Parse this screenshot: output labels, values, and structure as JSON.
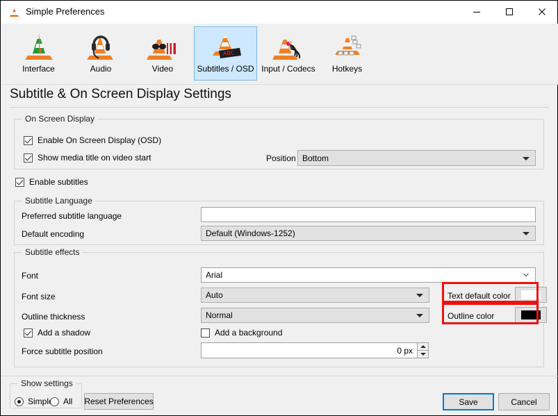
{
  "window": {
    "title": "Simple Preferences",
    "icon": "vlc-cone-icon",
    "minimize_label": "—",
    "maximize_label": "□",
    "close_label": "✕"
  },
  "toolbar": {
    "tabs": [
      {
        "label": "Interface",
        "icon": "vlc-interface-icon",
        "selected": false
      },
      {
        "label": "Audio",
        "icon": "vlc-audio-icon",
        "selected": false
      },
      {
        "label": "Video",
        "icon": "vlc-video-icon",
        "selected": false
      },
      {
        "label": "Subtitles / OSD",
        "icon": "vlc-subtitles-icon",
        "selected": true
      },
      {
        "label": "Input / Codecs",
        "icon": "vlc-input-icon",
        "selected": false
      },
      {
        "label": "Hotkeys",
        "icon": "vlc-hotkeys-icon",
        "selected": false
      }
    ]
  },
  "page": {
    "title": "Subtitle & On Screen Display Settings"
  },
  "osd_group": {
    "legend": "On Screen Display",
    "enable_osd": {
      "label": "Enable On Screen Display (OSD)",
      "checked": true
    },
    "show_title": {
      "label": "Show media title on video start",
      "checked": true
    },
    "position_label": "Position",
    "position_value": "Bottom"
  },
  "enable_subtitles": {
    "label": "Enable subtitles",
    "checked": true
  },
  "language_group": {
    "legend": "Subtitle Language",
    "preferred_label": "Preferred subtitle language",
    "preferred_value": "",
    "preferred_placeholder": "",
    "encoding_label": "Default encoding",
    "encoding_value": "Default (Windows-1252)"
  },
  "effects_group": {
    "legend": "Subtitle effects",
    "font_label": "Font",
    "font_value": "Arial",
    "font_size_label": "Font size",
    "font_size_value": "Auto",
    "outline_thickness_label": "Outline thickness",
    "outline_thickness_value": "Normal",
    "text_default_color_label": "Text default color",
    "text_default_color_value": "#ffffff",
    "outline_color_label": "Outline color",
    "outline_color_value": "#000000",
    "add_shadow": {
      "label": "Add a shadow",
      "checked": true
    },
    "add_background": {
      "label": "Add a background",
      "checked": false
    },
    "force_position_label": "Force subtitle position",
    "force_position_value": "0 px"
  },
  "annotations": {
    "highlight_color": "#ee1111",
    "boxes": [
      "text-default-color-row",
      "outline-color-row"
    ]
  },
  "footer": {
    "show_settings_legend": "Show settings",
    "simple_label": "Simple",
    "simple_selected": true,
    "all_label": "All",
    "all_selected": false,
    "reset_label": "Reset Preferences",
    "save_label": "Save",
    "cancel_label": "Cancel"
  }
}
